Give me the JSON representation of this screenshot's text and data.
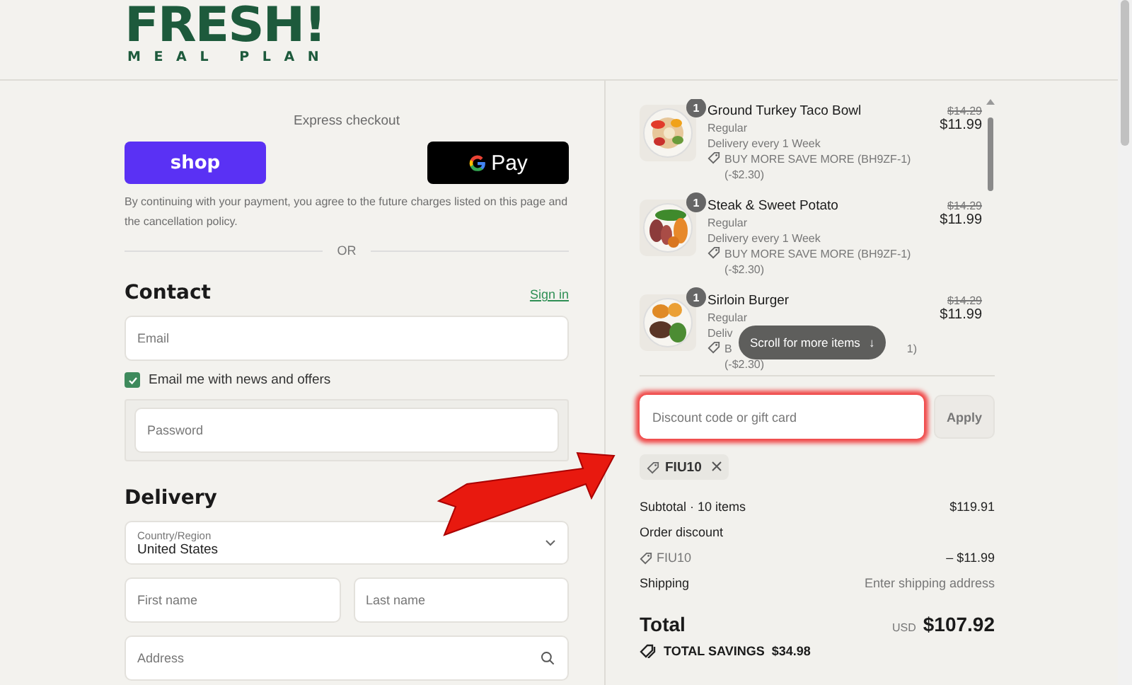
{
  "header": {
    "logo_title": "FRESH!",
    "logo_subtitle": "MEAL PLAN"
  },
  "express": {
    "title": "Express checkout",
    "buttons": [
      {
        "kind": "shop",
        "label": "shop"
      },
      {
        "kind": "gpay",
        "label": "Pay"
      }
    ],
    "terms": "By continuing with your payment, you agree to the future charges listed on this page and the cancellation policy.",
    "divider": "OR"
  },
  "contact": {
    "heading": "Contact",
    "sign_in": "Sign in",
    "email": {
      "placeholder": "Email"
    },
    "newsletter": {
      "label": "Email me with news and offers",
      "checked": true
    },
    "password": {
      "placeholder": "Password"
    }
  },
  "delivery": {
    "heading": "Delivery",
    "country": {
      "label": "Country/Region",
      "value": "United States"
    },
    "first_name": {
      "placeholder": "First name"
    },
    "last_name": {
      "placeholder": "Last name"
    },
    "address": {
      "placeholder": "Address"
    }
  },
  "cart": {
    "items": [
      {
        "quantity": "1",
        "name": "Ground Turkey Taco Bowl",
        "variant": "Regular",
        "delivery": "Delivery every 1 Week",
        "promo": [
          "BUY MORE SAVE MORE (BH9ZF-1)",
          "(-$2.30)"
        ],
        "old_price": "$14.29",
        "price": "$11.99"
      },
      {
        "quantity": "1",
        "name": "Steak & Sweet Potato",
        "variant": "Regular",
        "delivery": "Delivery every 1 Week",
        "promo": [
          "BUY MORE SAVE MORE (BH9ZF-1)",
          "(-$2.30)"
        ],
        "old_price": "$14.29",
        "price": "$11.99"
      },
      {
        "quantity": "1",
        "name": "Sirloin Burger",
        "variant": "Regular",
        "delivery": "Deliv",
        "promo": [
          "B",
          "(-$2.30)"
        ],
        "promo_tail": "1)",
        "old_price": "$14.29",
        "price": "$11.99"
      }
    ],
    "scroll_hint": "Scroll for more items",
    "scroll_hint_icon": "↓"
  },
  "discount": {
    "placeholder": "Discount code or gift card",
    "apply": "Apply",
    "highlighted": true,
    "applied_code": "FIU10"
  },
  "summary": {
    "subtotal_label": "Subtotal · 10 items",
    "subtotal": "$119.91",
    "discount_label": "Order discount",
    "discount_code": "FIU10",
    "discount_amount": "– $11.99",
    "shipping_label": "Shipping",
    "shipping_value": "Enter shipping address",
    "total_label": "Total",
    "currency": "USD",
    "total": "$107.92",
    "savings_label": "TOTAL SAVINGS",
    "savings": "$34.98"
  },
  "annotation": {
    "kind": "arrow"
  }
}
